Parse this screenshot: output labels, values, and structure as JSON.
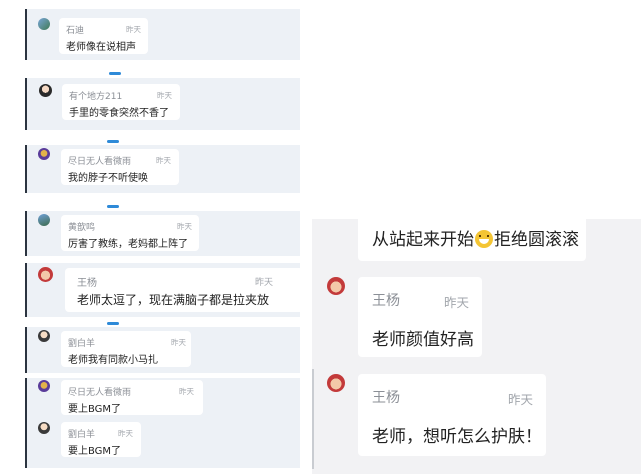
{
  "left_comments": [
    {
      "name": "石迪",
      "time": "昨天",
      "text": "老师像在说相声"
    },
    {
      "name": "有个地方211",
      "time": "昨天",
      "text": "手里的零食突然不香了"
    },
    {
      "name": "尽日无人看微雨",
      "time": "昨天",
      "text": "我的脖子不听使唤"
    },
    {
      "name": "黄歆鸣",
      "time": "昨天",
      "text": "厉害了教练，老妈都上阵了"
    },
    {
      "name": "王杨",
      "time": "昨天",
      "text": "老师太逗了，现在满脑子都是拉夹放"
    },
    {
      "name": "劉白羊",
      "time": "昨天",
      "text": "老师我有同款小马扎"
    },
    {
      "name": "尽日无人看微雨",
      "time": "昨天",
      "text": "要上BGM了"
    },
    {
      "name": "劉白羊",
      "time": "昨天",
      "text": "要上BGM了"
    }
  ],
  "right_chat": {
    "top_text_before": "从站起来开始",
    "top_text_emoji": "grinning-face-emoji",
    "top_text_after": "拒绝圆滚滚",
    "messages": [
      {
        "name": "王杨",
        "time": "昨天",
        "text": "老师颜值好高"
      },
      {
        "name": "王杨",
        "time": "昨天",
        "text": "老师，想听怎么护肤！"
      }
    ]
  },
  "colors": {
    "accent": "#2e8ad8",
    "strip_bg": "#edf1f6",
    "panel_bg": "#f2f2f4"
  }
}
